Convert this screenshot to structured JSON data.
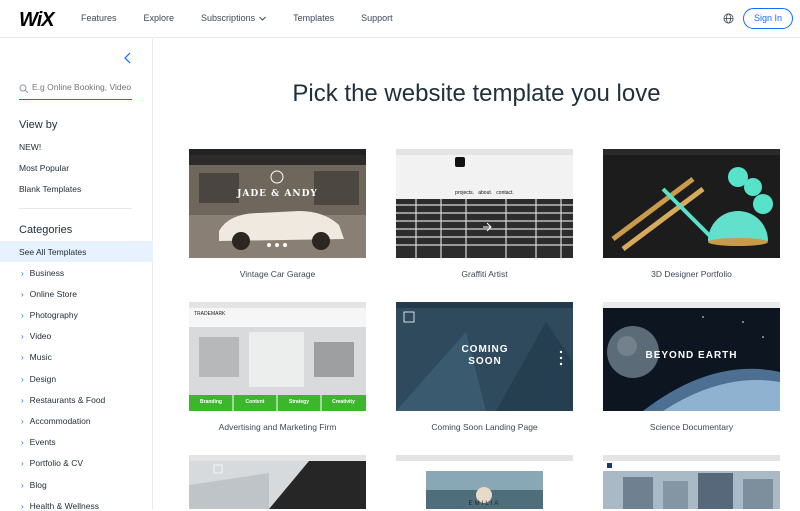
{
  "header": {
    "logo": "WiX",
    "nav": [
      "Features",
      "Explore",
      "Subscriptions",
      "Templates",
      "Support"
    ],
    "sign_in": "Sign In",
    "icons": [
      "globe-icon"
    ]
  },
  "sidebar": {
    "search_placeholder": "E.g Online Booking, Video",
    "view_by_title": "View by",
    "view_by": [
      "NEW!",
      "Most Popular",
      "Blank Templates"
    ],
    "categories_title": "Categories",
    "selected_category": "See All Templates",
    "categories": [
      "Business",
      "Online Store",
      "Photography",
      "Video",
      "Music",
      "Design",
      "Restaurants & Food",
      "Accommodation",
      "Events",
      "Portfolio & CV",
      "Blog",
      "Health & Wellness"
    ]
  },
  "main": {
    "headline": "Pick the website template you love",
    "templates": [
      {
        "name": "Vintage Car Garage",
        "thumb_text": "JADE & ANDY"
      },
      {
        "name": "Graffiti Artist",
        "thumb_text": "projects.   about.   contact."
      },
      {
        "name": "3D Designer Portfolio",
        "thumb_text": ""
      },
      {
        "name": "Advertising and Marketing Firm",
        "thumb_text": "TRADEMARK",
        "thumb_buttons": [
          "Branding",
          "Content",
          "Strategy",
          "Creativity"
        ]
      },
      {
        "name": "Coming Soon Landing Page",
        "thumb_text": "COMING SOON"
      },
      {
        "name": "Science Documentary",
        "thumb_text": "BEYOND EARTH"
      }
    ],
    "third_row_texts": [
      "EMILIA"
    ]
  },
  "colors": {
    "accent": "#116dff",
    "selected_bg": "#e8f1ff",
    "green": "#3cb72c"
  }
}
